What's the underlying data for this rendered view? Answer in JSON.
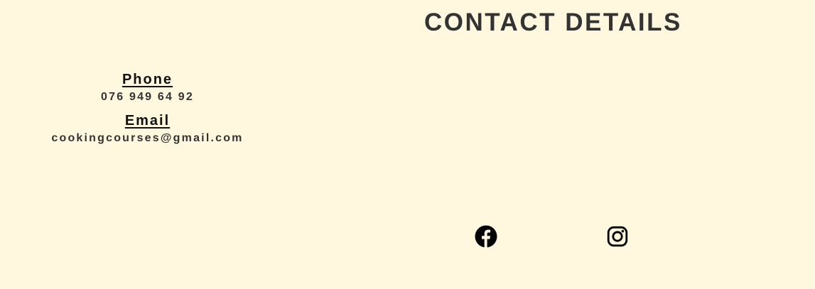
{
  "page": {
    "title": "CONTACT DETAILS"
  },
  "contact": {
    "phone_label": "Phone",
    "phone_value": "076 949 64 92",
    "email_label": "Email",
    "email_value": "cookingcourses@gmail.com"
  },
  "social": {
    "facebook_icon": "facebook-icon",
    "instagram_icon": "instagram-icon"
  },
  "colors": {
    "background": "#fff7de",
    "text": "#333333",
    "icon": "#000000"
  }
}
